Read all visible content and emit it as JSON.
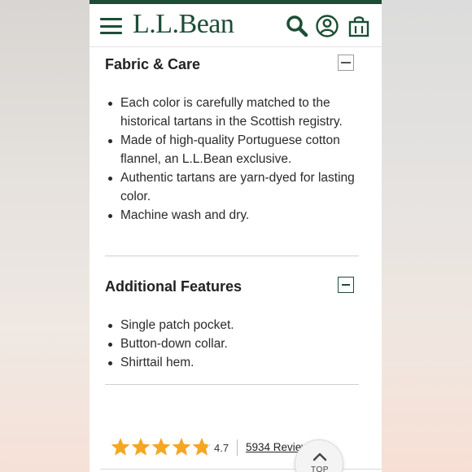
{
  "header": {
    "logo": "L.L.Bean",
    "brand_color": "#1d4d36"
  },
  "fabric_care": {
    "title": "Fabric & Care",
    "expanded": true,
    "items": [
      "Each color is carefully matched to the historical tartans in the Scottish registry.",
      "Made of high-quality Portuguese cotton flannel, an L.L.Bean exclusive.",
      "Authentic tartans are yarn-dyed for lasting color.",
      "Machine wash and dry."
    ]
  },
  "additional_features": {
    "title": "Additional Features",
    "expanded": true,
    "items": [
      "Single patch pocket.",
      "Button-down collar.",
      "Shirttail hem."
    ]
  },
  "rating": {
    "stars": 4.7,
    "value": "4.7",
    "reviews_label": "5934 Reviews",
    "star_color": "#f5a623"
  },
  "scroll_top": {
    "label": "TOP"
  },
  "icons": [
    "hamburger-menu-icon",
    "search-icon",
    "account-icon",
    "shopping-bag-icon",
    "minus-icon",
    "star-icon",
    "chevron-up-icon"
  ]
}
